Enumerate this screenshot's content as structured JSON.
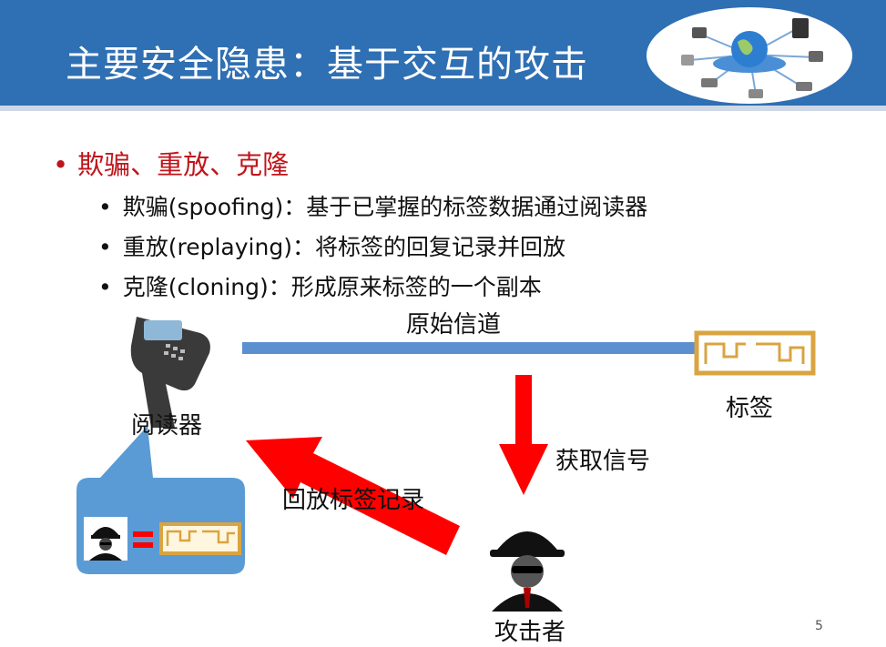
{
  "slide": {
    "title": "主要安全隐患：基于交互的攻击",
    "page_number": "5"
  },
  "bullets": {
    "main": "欺骗、重放、克隆",
    "bullet_glyph": "•",
    "items": [
      "欺骗(spoofing)：基于已掌握的标签数据通过阅读器",
      "重放(replaying)：将标签的回复记录并回放",
      "克隆(cloning)：形成原来标签的一个副本"
    ]
  },
  "diagram": {
    "channel_label": "原始信道",
    "reader_label": "阅读器",
    "tag_label": "标签",
    "acquire_label": "获取信号",
    "replay_label": "回放标签记录",
    "attacker_label": "攻击者",
    "colors": {
      "header": "#2f6fb3",
      "accent_red": "#ff0000",
      "channel_line": "#5b8fd0",
      "callout_fill": "#5b9bd5",
      "tag_gold": "#d9a441"
    }
  }
}
